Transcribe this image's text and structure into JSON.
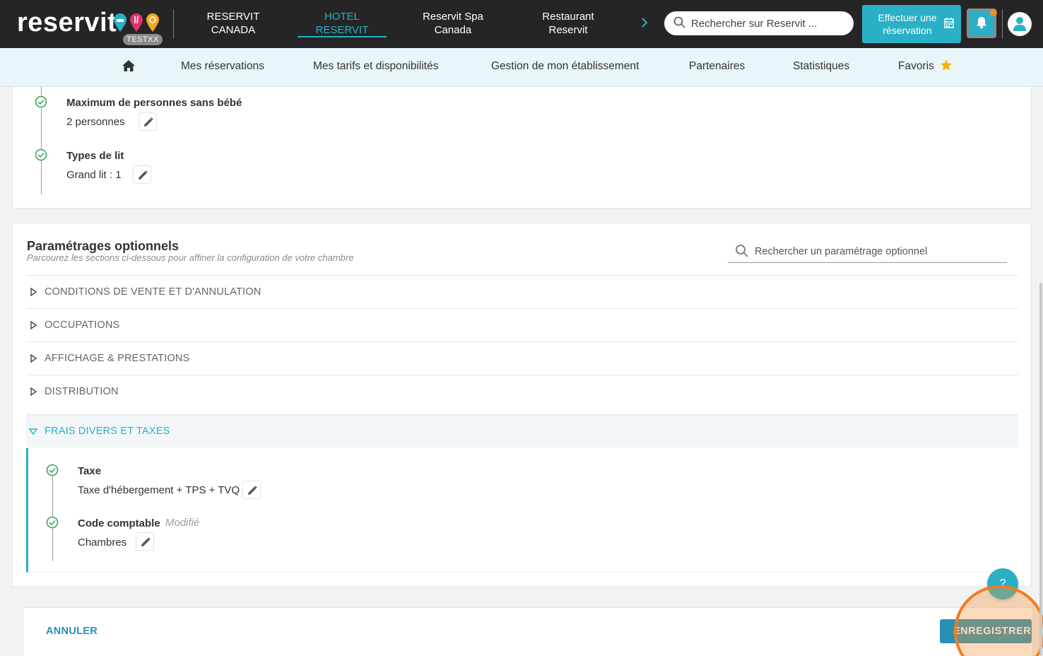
{
  "app": {
    "logo_text": "reservit",
    "logo_badge": "TESTXX",
    "colors": {
      "accent": "#2ab0c6",
      "topbar": "#252525",
      "nav_bg": "#e9f6f9",
      "save_button": "#2a8fb5",
      "highlight": "#f07d1e"
    }
  },
  "establishments": [
    {
      "line1": "RESERVIT",
      "line2": "CANADA",
      "active": false
    },
    {
      "line1": "HOTEL",
      "line2": "RESERVIT",
      "active": true
    },
    {
      "line1": "Reservit Spa",
      "line2": "Canada",
      "active": false
    },
    {
      "line1": "Restaurant",
      "line2": "Reservit",
      "active": false
    }
  ],
  "topbar": {
    "search_placeholder": "Rechercher sur Reservit ...",
    "reserve_button": {
      "line1": "Effectuer une",
      "line2": "réservation"
    },
    "icons": [
      "chevron-right-icon",
      "search-icon",
      "calendar-icon",
      "bell-icon",
      "user-icon"
    ]
  },
  "nav": {
    "items": [
      "Mes réservations",
      "Mes tarifs et disponibilités",
      "Gestion de mon établissement",
      "Partenaires",
      "Statistiques",
      "Favoris"
    ]
  },
  "room_fields": [
    {
      "title": "Maximum de personnes sans bébé",
      "value": "2 personnes"
    },
    {
      "title": "Types de lit",
      "value": "Grand lit : 1"
    }
  ],
  "optional_settings": {
    "title": "Paramétrages optionnels",
    "subtitle": "Parcourez les sections ci-dessous pour affiner la configuration de votre chambre",
    "search_placeholder": "Rechercher un paramétrage optionnel",
    "sections": [
      {
        "label": "CONDITIONS DE VENTE ET D'ANNULATION",
        "expanded": false
      },
      {
        "label": "OCCUPATIONS",
        "expanded": false
      },
      {
        "label": "AFFICHAGE & PRESTATIONS",
        "expanded": false
      },
      {
        "label": "DISTRIBUTION",
        "expanded": false
      },
      {
        "label": "FRAIS DIVERS ET TAXES",
        "expanded": true
      }
    ],
    "expanded_fields": [
      {
        "title": "Taxe",
        "value": "Taxe d'hébergement + TPS + TVQ",
        "modified": ""
      },
      {
        "title": "Code comptable",
        "value": "Chambres",
        "modified": "Modifié"
      }
    ]
  },
  "footer": {
    "cancel_label": "ANNULER",
    "save_label": "ENREGISTRER",
    "help_label": "?"
  }
}
